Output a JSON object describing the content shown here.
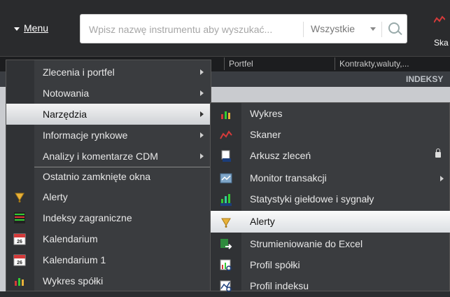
{
  "topbar": {
    "menu_label": "Menu",
    "search_placeholder": "Wpisz nazwę instrumentu aby wyszukać...",
    "search_filter": "Wszystkie",
    "skaner_label": "Ska"
  },
  "background": {
    "tabs": [
      "Portfel",
      "Kontrakty,waluty,..."
    ],
    "section_label": "INDEKSY"
  },
  "main_menu": {
    "items": [
      {
        "label": "Zlecenia i portfel"
      },
      {
        "label": "Notowania"
      },
      {
        "label": "Narzędzia"
      },
      {
        "label": "Informacje rynkowe"
      },
      {
        "label": "Analizy i komentarze CDM"
      }
    ],
    "recent_title": "Ostatnio zamknięte okna",
    "recent": [
      {
        "label": "Alerty",
        "icon": "alert-bell-icon"
      },
      {
        "label": "Indeksy zagraniczne",
        "icon": "gpw-quotes-icon"
      },
      {
        "label": "Kalendarium",
        "icon": "calendar-icon",
        "day": "26"
      },
      {
        "label": "Kalendarium 1",
        "icon": "calendar-icon",
        "day": "26"
      },
      {
        "label": "Wykres spółki",
        "icon": "chart-icon"
      }
    ]
  },
  "submenu": {
    "items": [
      {
        "label": "Wykres"
      },
      {
        "label": "Skaner"
      },
      {
        "label": "Arkusz zleceń"
      },
      {
        "label": "Monitor transakcji"
      },
      {
        "label": "Statystyki giełdowe i sygnały"
      },
      {
        "label": "Alerty"
      },
      {
        "label": "Strumieniowanie do Excel"
      },
      {
        "label": "Profil spółki"
      },
      {
        "label": "Profil indeksu"
      }
    ]
  },
  "colors": {
    "accent_red": "#d43a3a",
    "highlight": "#e9ebee"
  }
}
